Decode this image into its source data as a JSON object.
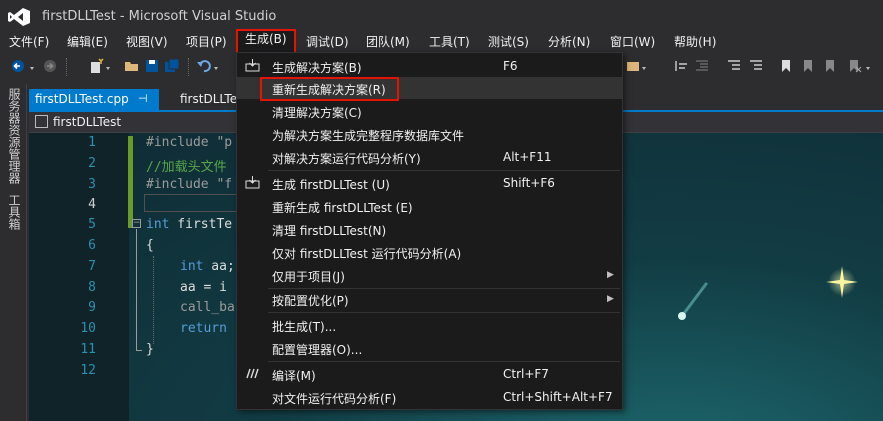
{
  "window": {
    "title": "firstDLLTest - Microsoft Visual Studio"
  },
  "menubar": {
    "items": [
      {
        "label": "文件(F)"
      },
      {
        "label": "编辑(E)"
      },
      {
        "label": "视图(V)"
      },
      {
        "label": "项目(P)"
      },
      {
        "label": "生成(B)"
      },
      {
        "label": "调试(D)"
      },
      {
        "label": "团队(M)"
      },
      {
        "label": "工具(T)"
      },
      {
        "label": "测试(S)"
      },
      {
        "label": "分析(N)"
      },
      {
        "label": "窗口(W)"
      },
      {
        "label": "帮助(H)"
      }
    ]
  },
  "side_panels": {
    "server_explorer": "服务器资源管理器",
    "toolbox": "工具箱"
  },
  "tabs": [
    {
      "label": "firstDLLTest.cpp",
      "active": true
    },
    {
      "label": "firstDLLTe"
    }
  ],
  "navbar": {
    "scope": "firstDLLTest"
  },
  "editor": {
    "line_numbers": [
      "1",
      "2",
      "3",
      "4",
      "5",
      "6",
      "7",
      "8",
      "9",
      "10",
      "11",
      "12"
    ],
    "current_line": "4",
    "lines": {
      "l1": "#include \"p",
      "l2": "//加载头文件",
      "l3": "#include \"f",
      "l5_kw": "int",
      "l5_tx": " firstTe",
      "l6": "{",
      "l7_kw": "int",
      "l7_tx": " aa;",
      "l8": "aa = i",
      "l9": "call_ba",
      "l10": "return",
      "l11": "}"
    }
  },
  "build_menu": {
    "items": [
      {
        "label": "生成解决方案(B)",
        "shortcut": "F6"
      },
      {
        "label": "重新生成解决方案(R)",
        "shortcut": ""
      },
      {
        "label": "清理解决方案(C)",
        "shortcut": ""
      },
      {
        "label": "为解决方案生成完整程序数据库文件",
        "shortcut": ""
      },
      {
        "label": "对解决方案运行代码分析(Y)",
        "shortcut": "Alt+F11"
      },
      {
        "label": "生成 firstDLLTest (U)",
        "shortcut": "Shift+F6"
      },
      {
        "label": "重新生成 firstDLLTest (E)",
        "shortcut": ""
      },
      {
        "label": "清理 firstDLLTest(N)",
        "shortcut": ""
      },
      {
        "label": "仅对 firstDLLTest 运行代码分析(A)",
        "shortcut": ""
      },
      {
        "label": "仅用于项目(J)",
        "shortcut": ""
      },
      {
        "label": "按配置优化(P)",
        "shortcut": ""
      },
      {
        "label": "批生成(T)...",
        "shortcut": ""
      },
      {
        "label": "配置管理器(O)...",
        "shortcut": ""
      },
      {
        "label": "编译(M)",
        "shortcut": "Ctrl+F7"
      },
      {
        "label": "对文件运行代码分析(F)",
        "shortcut": "Ctrl+Shift+Alt+F7"
      }
    ],
    "highlighted": "重新生成解决方案(R)"
  },
  "colors": {
    "accent": "#007acc",
    "highlight_box": "#e51400",
    "background": "#2d2d30",
    "menu_bg": "#1b1b1c"
  }
}
